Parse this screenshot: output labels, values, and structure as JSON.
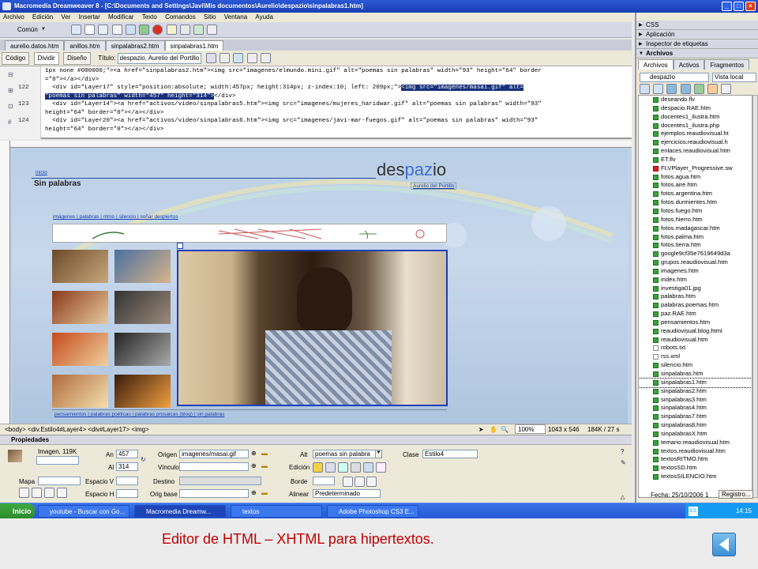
{
  "titlebar": {
    "title": "Macromedia Dreamweaver 8 - [C:\\Documents and Settings\\Javi\\Mis documentos\\Aurelio\\despazio\\sinpalabras1.htm]"
  },
  "menubar": {
    "items": [
      "Archivo",
      "Edición",
      "Ver",
      "Insertar",
      "Modificar",
      "Texto",
      "Comandos",
      "Sitio",
      "Ventana",
      "Ayuda"
    ]
  },
  "insertbar": {
    "category": "Común"
  },
  "doctabs": [
    "aurelio.datos.htm",
    "anillos.htm",
    "sinpalabras2.htm",
    "sinpalabras1.htm"
  ],
  "doctoolbar": {
    "code": "Código",
    "split": "Dividir",
    "design": "Diseño",
    "title_label": "Título:",
    "title_value": "despazio, Aurelio del Portillo, p"
  },
  "code": {
    "lines": [
      {
        "num": "",
        "text": "1px none #000000;\"><a href=\"sinpalabras2.htm\"><img src=\"imagenes/elmundo.mini.gif\" alt=\"poemas sin palabras\" width=\"93\" height=\"64\" border"
      },
      {
        "num": "",
        "text": "=\"0\"></a></div>"
      },
      {
        "num": "122",
        "text": "  <div id=\"Layer17\" style=\"position:absolute; width:457px; height:314px; z-index:10; left: 209px;\">",
        "hl": "<img src=\"imagenes/masai.gif\" alt="
      },
      {
        "num": "",
        "text": "",
        "hl": "\"poemas sin palabras\" width=\"457\" height=\"314\">",
        "tail": "</div>"
      },
      {
        "num": "123",
        "text": "  <div id=\"Layer14\"><a href=\"activos/video/sinpalabras5.htm\"><img src=\"imagenes/mujeres_haridwar.gif\" alt=\"poemas sin palabras\" width=\"93\""
      },
      {
        "num": "",
        "text": "height=\"64\" border=\"0\"></a></div>"
      },
      {
        "num": "124",
        "text": "  <div id=\"Layer20\"><a href=\"activos/video/sinpalabras6.htm\"><img src=\"imagenes/javi-mar-fuegos.gif\" alt=\"poemas sin palabras\" width=\"93\""
      },
      {
        "num": "",
        "text": "height=\"64\" border=\"0\"></a></div>"
      }
    ]
  },
  "design": {
    "inicio": "inicio",
    "heading": "Sin palabras",
    "logo_a": "des",
    "logo_b": "paz",
    "logo_c": "io",
    "author_link": "Aurelio del Portillo",
    "nav_links": "imágenes | palabras | ritmo | silencio | soñar despiertos",
    "footer_links": "pensamientos | palabras poéticas | palabras prosaicas (blog) | sin palabras"
  },
  "statusbar": {
    "tags": "<body> <div.Estilo4#Layer4> <div#Layer17> <img>",
    "zoom": "100%",
    "size": "1043 x 546",
    "weight": "184K / 27 s"
  },
  "properties": {
    "title": "Propiedades",
    "type": "Imagen, 119K",
    "an_label": "An",
    "an": "457",
    "al_label": "Al",
    "al": "314",
    "origen_label": "Origen",
    "origen": "imagenes/masai.gif",
    "vinculo_label": "Vínculo",
    "vinculo": "",
    "alt_label": "Alt",
    "alt": "poemas sin palabra",
    "clase_label": "Clase",
    "clase": "Estilo4",
    "edicion_label": "Edición",
    "mapa_label": "Mapa",
    "espv_label": "Espacio V",
    "esph_label": "Espacio H",
    "destino_label": "Destino",
    "origbase_label": "Orig base",
    "borde_label": "Borde",
    "alinear_label": "Alinear",
    "alinear": "Predeterminado"
  },
  "rightpanel": {
    "css": "CSS",
    "aplicacion": "Aplicación",
    "inspector": "Inspector de etiquetas",
    "archivos": "Archivos",
    "tabs": [
      "Archivos",
      "Activos",
      "Fragmentos"
    ],
    "site": "despazio",
    "view": "Vista local",
    "files": [
      "deseando.flv",
      "despacio.RAE.htm",
      "docentes1_ilustra.htm",
      "docentes1_ilustra.php",
      "ejemplos.reaudiovisual.ht",
      "ejercicios.reaudiovisual.h",
      "enlaces.reaudiovisual.htm",
      "ET.flv",
      "FLVPlayer_Progressive.sw",
      "fotos.agua.htm",
      "fotos.aire.htm",
      "fotos.argentina.htm",
      "fotos.durmientes.htm",
      "fotos.fuego.htm",
      "fotos.hierro.htm",
      "fotos.madagascar.htm",
      "fotos.palma.htm",
      "fotos.tierra.htm",
      "google9cf35e7619649d3a",
      "grupos.reaudiovisual.htm",
      "imagenes.htm",
      "index.htm",
      "investiga01.jpg",
      "palabras.htm",
      "palabras.poemas.htm",
      "paz.RAE.htm",
      "pensamientos.htm",
      "reaudiovisual.blog.html",
      "reaudiovisual.htm",
      "robots.txt",
      "rss.xml",
      "silencio.htm",
      "sinpalabras.htm",
      "sinpalabras1.htm",
      "sinpalabras2.htm",
      "sinpalabras3.htm",
      "sinpalabras4.htm",
      "sinpalabras7.htm",
      "sinpalabras8.htm",
      "sinpalabrasX.htm",
      "temario.reaudiovisual.htm",
      "textos.reaudiovisual.htm",
      "textosRITMO.htm",
      "textosSD.htm",
      "textosSILENCIO.htm"
    ],
    "selected_index": 33,
    "date": "Fecha: 25/10/2006 1",
    "log": "Registro..."
  },
  "taskbar": {
    "start": "Inicio",
    "tasks": [
      "youtube - Buscar con Go...",
      "Macromedia Dreamw...",
      "textos",
      "Adobe Photoshop CS3 E..."
    ],
    "lang": "ES",
    "time": "14:15"
  },
  "caption": "Editor de HTML – XHTML para hipertextos."
}
